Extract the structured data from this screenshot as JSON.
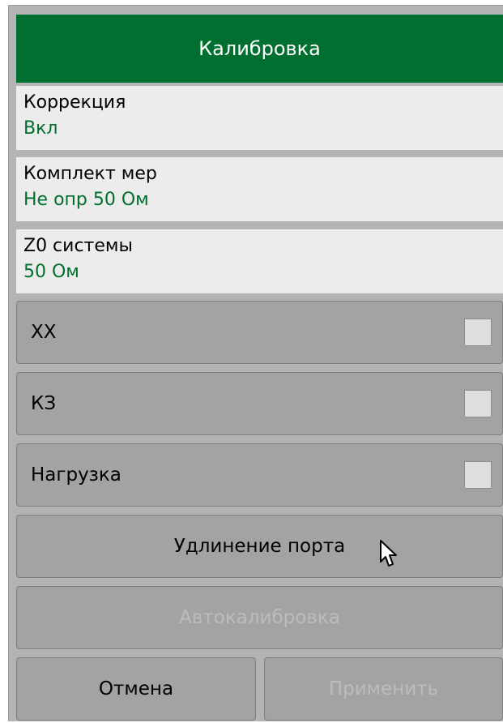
{
  "header": {
    "title": "Калибровка"
  },
  "params": [
    {
      "label": "Коррекция",
      "value": "Вкл"
    },
    {
      "label": "Комплект мер",
      "value": "Не опр 50 Ом"
    },
    {
      "label": "Z0 системы",
      "value": "50 Ом"
    }
  ],
  "standards": [
    {
      "label": "XX",
      "checked": false
    },
    {
      "label": "КЗ",
      "checked": false
    },
    {
      "label": "Нагрузка",
      "checked": false
    }
  ],
  "buttons": {
    "port_extension": "Удлинение порта",
    "autocalibration": "Автокалибровка",
    "cancel": "Отмена",
    "apply": "Применить"
  },
  "colors": {
    "header_bg": "#006f2f",
    "value_text": "#006f2f",
    "button_bg": "#a3a3a3",
    "disabled_text": "#bcbcbc"
  }
}
